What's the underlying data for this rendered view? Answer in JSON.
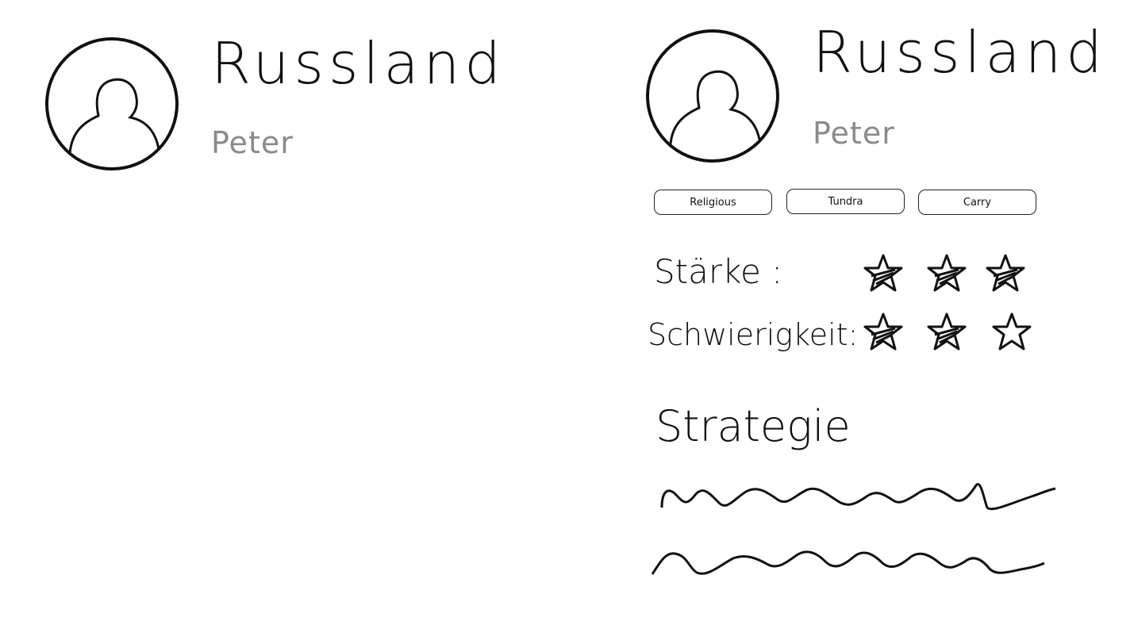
{
  "cards": [
    {
      "title": "Russland",
      "player": "Peter",
      "avatar_icon": "user-avatar-icon"
    },
    {
      "title": "Russland",
      "player": "Peter",
      "avatar_icon": "user-avatar-icon",
      "tags": [
        "Religious",
        "Tundra",
        "Carry"
      ],
      "stats": [
        {
          "label": "Stärke :",
          "rating": 3,
          "max": 3
        },
        {
          "label": "Schwierigkeit:",
          "rating": 2,
          "max": 3
        }
      ],
      "strategy_title": "Strategie",
      "strategy_lines": 2
    }
  ],
  "colors": {
    "ink": "#111111",
    "subtitle": "#8a8a8a",
    "background": "#ffffff"
  }
}
